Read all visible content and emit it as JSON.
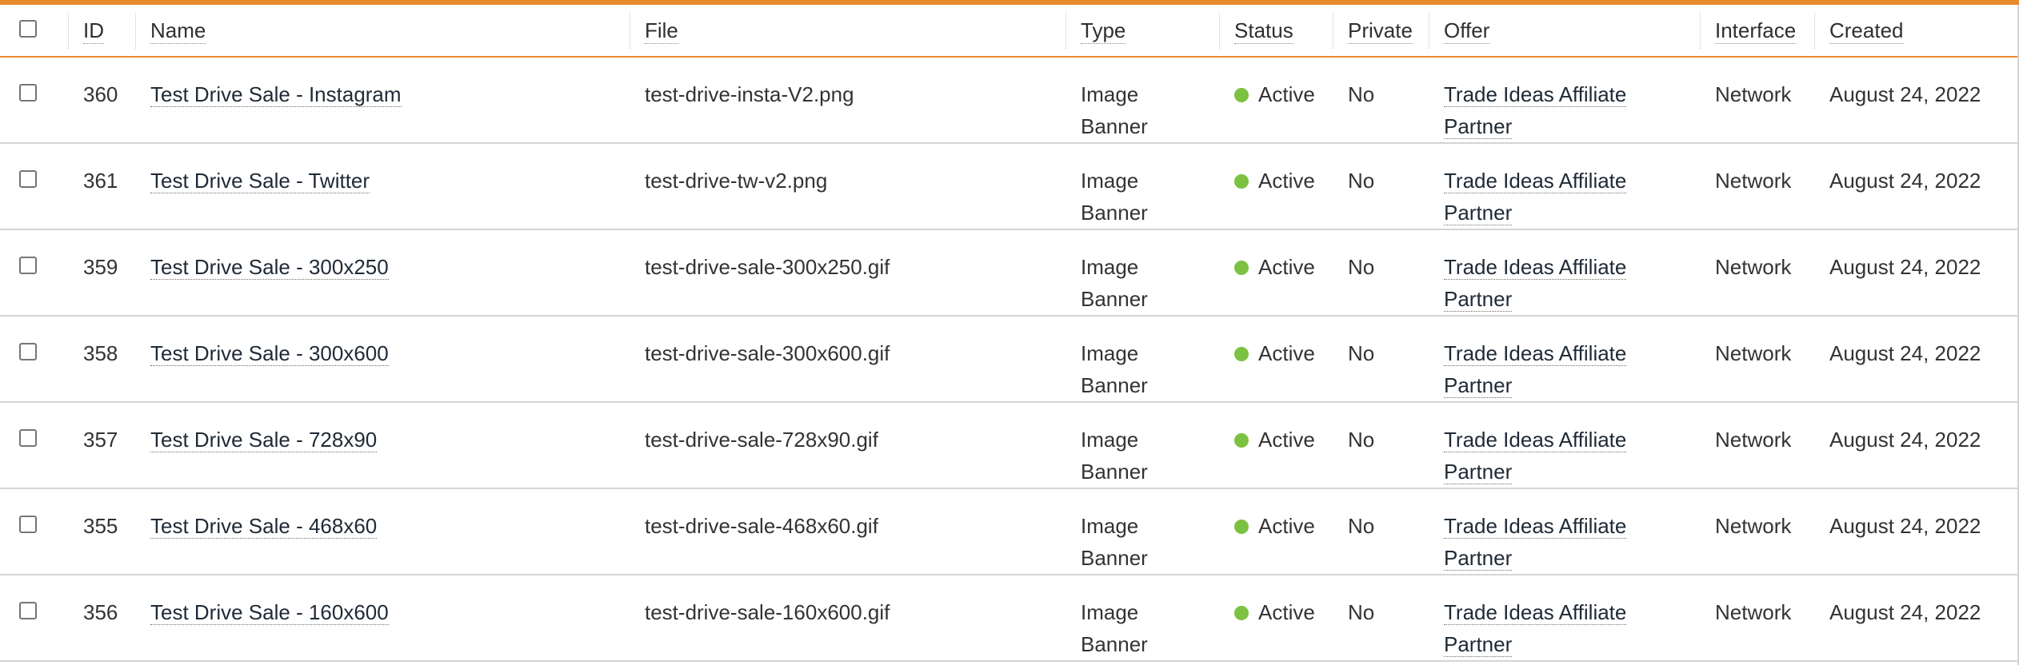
{
  "colors": {
    "accent": "#e8892b",
    "status_active": "#7cc242"
  },
  "columns": {
    "id": "ID",
    "name": "Name",
    "file": "File",
    "type": "Type",
    "status": "Status",
    "private": "Private",
    "offer": "Offer",
    "interface": "Interface",
    "created": "Created"
  },
  "rows": [
    {
      "id": "360",
      "name": "Test Drive Sale - Instagram",
      "file": "test-drive-insta-V2.png",
      "type_line1": "Image",
      "type_line2": "Banner",
      "status": "Active",
      "private": "No",
      "offer_line1": "Trade Ideas Affiliate",
      "offer_line2": "Partner",
      "interface": "Network",
      "created": "August 24, 2022"
    },
    {
      "id": "361",
      "name": "Test Drive Sale - Twitter",
      "file": "test-drive-tw-v2.png",
      "type_line1": "Image",
      "type_line2": "Banner",
      "status": "Active",
      "private": "No",
      "offer_line1": "Trade Ideas Affiliate",
      "offer_line2": "Partner",
      "interface": "Network",
      "created": "August 24, 2022"
    },
    {
      "id": "359",
      "name": "Test Drive Sale - 300x250",
      "file": "test-drive-sale-300x250.gif",
      "type_line1": "Image",
      "type_line2": "Banner",
      "status": "Active",
      "private": "No",
      "offer_line1": "Trade Ideas Affiliate",
      "offer_line2": "Partner",
      "interface": "Network",
      "created": "August 24, 2022"
    },
    {
      "id": "358",
      "name": "Test Drive Sale - 300x600",
      "file": "test-drive-sale-300x600.gif",
      "type_line1": "Image",
      "type_line2": "Banner",
      "status": "Active",
      "private": "No",
      "offer_line1": "Trade Ideas Affiliate",
      "offer_line2": "Partner",
      "interface": "Network",
      "created": "August 24, 2022"
    },
    {
      "id": "357",
      "name": "Test Drive Sale - 728x90",
      "file": "test-drive-sale-728x90.gif",
      "type_line1": "Image",
      "type_line2": "Banner",
      "status": "Active",
      "private": "No",
      "offer_line1": "Trade Ideas Affiliate",
      "offer_line2": "Partner",
      "interface": "Network",
      "created": "August 24, 2022"
    },
    {
      "id": "355",
      "name": "Test Drive Sale - 468x60",
      "file": "test-drive-sale-468x60.gif",
      "type_line1": "Image",
      "type_line2": "Banner",
      "status": "Active",
      "private": "No",
      "offer_line1": "Trade Ideas Affiliate",
      "offer_line2": "Partner",
      "interface": "Network",
      "created": "August 24, 2022"
    },
    {
      "id": "356",
      "name": "Test Drive Sale - 160x600",
      "file": "test-drive-sale-160x600.gif",
      "type_line1": "Image",
      "type_line2": "Banner",
      "status": "Active",
      "private": "No",
      "offer_line1": "Trade Ideas Affiliate",
      "offer_line2": "Partner",
      "interface": "Network",
      "created": "August 24, 2022"
    }
  ]
}
